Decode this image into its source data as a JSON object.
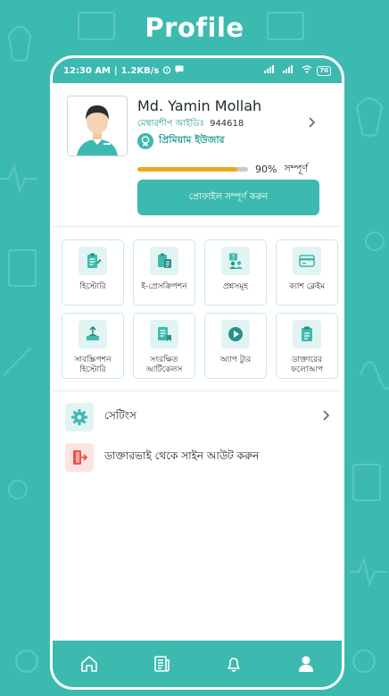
{
  "page": {
    "title": "Profile"
  },
  "statusbar": {
    "time": "12:30 AM",
    "speed": "1.2KB/s",
    "battery": "70"
  },
  "profile": {
    "name": "Md. Yamin Mollah",
    "member_label": "মেম্বারশীপ আইডিঃ",
    "member_id": "944618",
    "premium_label": "প্রিমিয়াম ইউজার",
    "progress_percent": 90,
    "progress_text": "90%",
    "complete_text": "সম্পূর্ণ",
    "complete_button": "প্রোফাইল সম্পূর্ণ করুন"
  },
  "grid": {
    "items": [
      {
        "label": "হিস্টোরি",
        "icon": "history-icon"
      },
      {
        "label": "ই-প্রেসক্রিপশন",
        "icon": "prescription-icon"
      },
      {
        "label": "প্রশ্নসমূহ",
        "icon": "questions-icon"
      },
      {
        "label": "ক্যাশ ক্লেইম",
        "icon": "cash-claim-icon"
      },
      {
        "label": "সাবস্ক্রিপশন হিস্টোরি",
        "icon": "subscription-icon"
      },
      {
        "label": "সংরক্ষিত আর্টিকেলস",
        "icon": "saved-articles-icon"
      },
      {
        "label": "অ্যাপ ট্যুর",
        "icon": "play-icon"
      },
      {
        "label": "ডাক্তারের ফলোআপ",
        "icon": "followup-icon"
      }
    ]
  },
  "menu": {
    "settings_label": "সেটিংস",
    "signout_label": "ডাক্তারভাই থেকে সাইন আউট করুন"
  },
  "colors": {
    "accent": "#3dbab0",
    "progress": "#f2a51d",
    "signout_bg": "#fde4e1",
    "signout_icon": "#e8534a"
  },
  "nav": [
    "home-icon",
    "articles-icon",
    "bell-icon",
    "profile-icon"
  ]
}
